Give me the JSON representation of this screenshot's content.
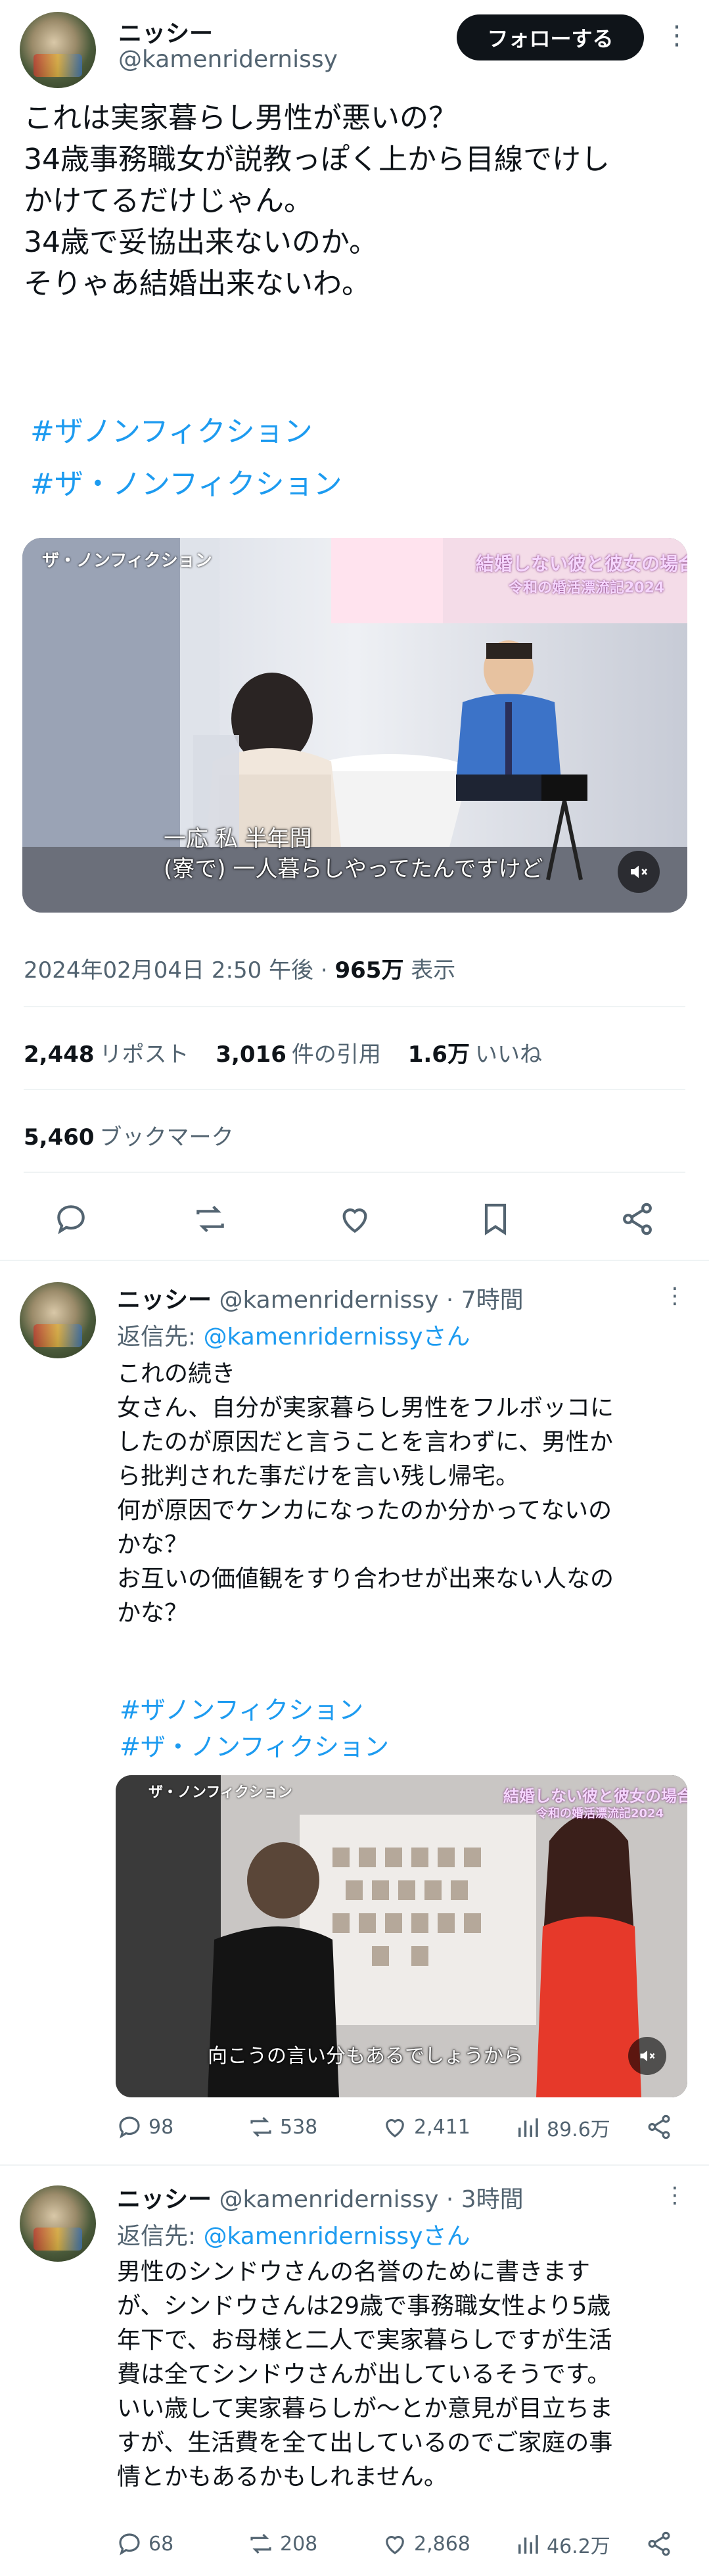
{
  "tweet": {
    "author_name": "ニッシー",
    "author_handle": "@kamenridernissy",
    "follow_label": "フォローする",
    "text_lines": [
      "これは実家暮らし男性が悪いの？",
      "34歳事務職女が説教っぽく上から目線でけし",
      "かけてるだけじゃん。",
      "34歳で妥協出来ないのか。",
      "そりゃあ結婚出来ないわ。"
    ],
    "hashtags": [
      "#ザノンフィクション",
      "#ザ・ノンフィクション"
    ],
    "media": {
      "show_label": "ザ・ノンフィクション",
      "overlay_title": "結婚しない彼と彼女の場合",
      "overlay_subtitle": "令和の婚活漂流記2024",
      "caption_lines": [
        "一応 私 半年間",
        "(寮で) 一人暮らしやってたんですけど"
      ]
    },
    "timestamp": "2024年02月04日 2:50 午後",
    "views_value": "965万",
    "views_label": "表示",
    "stats": {
      "reposts_value": "2,448",
      "reposts_label": "リポスト",
      "quotes_value": "3,016",
      "quotes_label": "件の引用",
      "likes_value": "1.6万",
      "likes_label": "いいね",
      "bookmarks_value": "5,460",
      "bookmarks_label": "ブックマーク"
    }
  },
  "replies": [
    {
      "author_name": "ニッシー",
      "author_handle": "@kamenridernissy",
      "time": "7時間",
      "reply_prefix": "返信先: ",
      "reply_target": "@kamenridernissyさん",
      "text_lines": [
        "これの続き",
        "女さん、自分が実家暮らし男性をフルボッコに",
        "したのが原因だと言うことを言わずに、男性か",
        "ら批判された事だけを言い残し帰宅。",
        "何が原因でケンカになったのか分かってないの",
        "かな？",
        "お互いの価値観をすり合わせが出来ない人なの",
        "かな？"
      ],
      "hashtags": [
        "#ザノンフィクション",
        "#ザ・ノンフィクション"
      ],
      "media": {
        "show_label": "ザ・ノンフィクション",
        "overlay_title": "結婚しない彼と彼女の場合",
        "overlay_subtitle": "令和の婚活漂流記2024",
        "caption": "向こうの言い分もあるでしょうから"
      },
      "counts": {
        "replies": "98",
        "reposts": "538",
        "likes": "2,411",
        "views": "89.6万"
      }
    },
    {
      "author_name": "ニッシー",
      "author_handle": "@kamenridernissy",
      "time": "3時間",
      "reply_prefix": "返信先: ",
      "reply_target": "@kamenridernissyさん",
      "text_lines": [
        "男性のシンドウさんの名誉のために書きます",
        "が、シンドウさんは29歳で事務職女性より5歳",
        "年下で、お母様と二人で実家暮らしですが生活",
        "費は全てシンドウさんが出しているそうです。",
        "いい歳して実家暮らしが〜とか意見が目立ちま",
        "すが、生活費を全て出しているのでご家庭の事",
        "情とかもあるかもしれません。"
      ],
      "counts": {
        "replies": "68",
        "reposts": "208",
        "likes": "2,868",
        "views": "46.2万"
      }
    }
  ],
  "colors": {
    "accent": "#1d9bf0",
    "text": "#0f1419",
    "muted": "#536471",
    "divider": "#eff3f4"
  }
}
